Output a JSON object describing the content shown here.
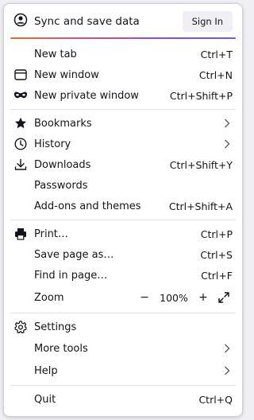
{
  "header": {
    "sync_label": "Sync and save data",
    "sign_in_label": "Sign In"
  },
  "items": {
    "new_tab": {
      "label": "New tab",
      "shortcut": "Ctrl+T"
    },
    "new_window": {
      "label": "New window",
      "shortcut": "Ctrl+N"
    },
    "new_private_window": {
      "label": "New private window",
      "shortcut": "Ctrl+Shift+P"
    },
    "bookmarks": {
      "label": "Bookmarks"
    },
    "history": {
      "label": "History"
    },
    "downloads": {
      "label": "Downloads",
      "shortcut": "Ctrl+Shift+Y"
    },
    "passwords": {
      "label": "Passwords"
    },
    "addons": {
      "label": "Add-ons and themes",
      "shortcut": "Ctrl+Shift+A"
    },
    "print": {
      "label": "Print…",
      "shortcut": "Ctrl+P"
    },
    "save_page": {
      "label": "Save page as…",
      "shortcut": "Ctrl+S"
    },
    "find": {
      "label": "Find in page…",
      "shortcut": "Ctrl+F"
    },
    "zoom": {
      "label": "Zoom",
      "minus": "−",
      "value": "100%",
      "plus": "+"
    },
    "settings": {
      "label": "Settings"
    },
    "more_tools": {
      "label": "More tools"
    },
    "help": {
      "label": "Help"
    },
    "quit": {
      "label": "Quit",
      "shortcut": "Ctrl+Q"
    }
  },
  "icons": {
    "account": "account-circle-icon",
    "new_window": "window-icon",
    "private": "private-mask-icon",
    "bookmarks": "star-icon",
    "history": "clock-icon",
    "downloads": "download-icon",
    "print": "printer-icon",
    "settings": "gear-icon",
    "chevron": "chevron-right-icon",
    "fullscreen": "fullscreen-icon"
  },
  "colors": {
    "accent_gradient": [
      "#e4712c",
      "#d54c8d",
      "#8b4cd6",
      "#6c5ce7"
    ],
    "text": "#15141a",
    "button_bg": "#f0f0f4"
  }
}
